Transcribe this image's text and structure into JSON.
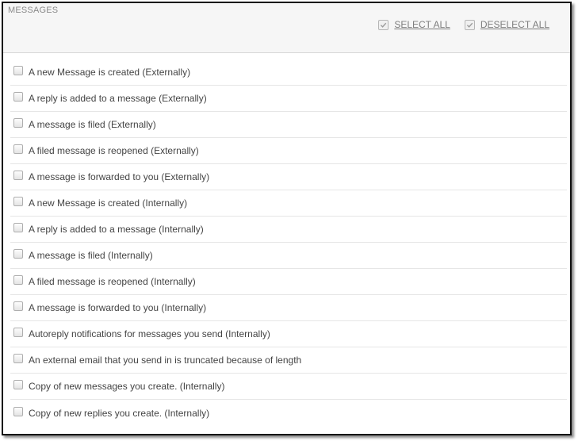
{
  "panel": {
    "title": "MESSAGES",
    "actions": {
      "select_all": "SELECT ALL",
      "deselect_all": "DESELECT ALL"
    }
  },
  "options": [
    {
      "label": "A new Message is created (Externally)",
      "checked": false
    },
    {
      "label": "A reply is added to a message (Externally)",
      "checked": false
    },
    {
      "label": "A message is filed (Externally)",
      "checked": false
    },
    {
      "label": "A filed message is reopened (Externally)",
      "checked": false
    },
    {
      "label": "A message is forwarded to you (Externally)",
      "checked": false
    },
    {
      "label": "A new Message is created (Internally)",
      "checked": false
    },
    {
      "label": "A reply is added to a message (Internally)",
      "checked": false
    },
    {
      "label": "A message is filed (Internally)",
      "checked": false
    },
    {
      "label": "A filed message is reopened (Internally)",
      "checked": false
    },
    {
      "label": "A message is forwarded to you (Internally)",
      "checked": false
    },
    {
      "label": "Autoreply notifications for messages you send (Internally)",
      "checked": false
    },
    {
      "label": "An external email that you send in is truncated because of length",
      "checked": false
    },
    {
      "label": "Copy of new messages you create. (Internally)",
      "checked": false
    },
    {
      "label": "Copy of new replies you create. (Internally)",
      "checked": false
    }
  ],
  "colors": {
    "header_bg": "#f6f6f6",
    "border": "#111111",
    "text": "#444444",
    "muted": "#8a8a8a"
  }
}
